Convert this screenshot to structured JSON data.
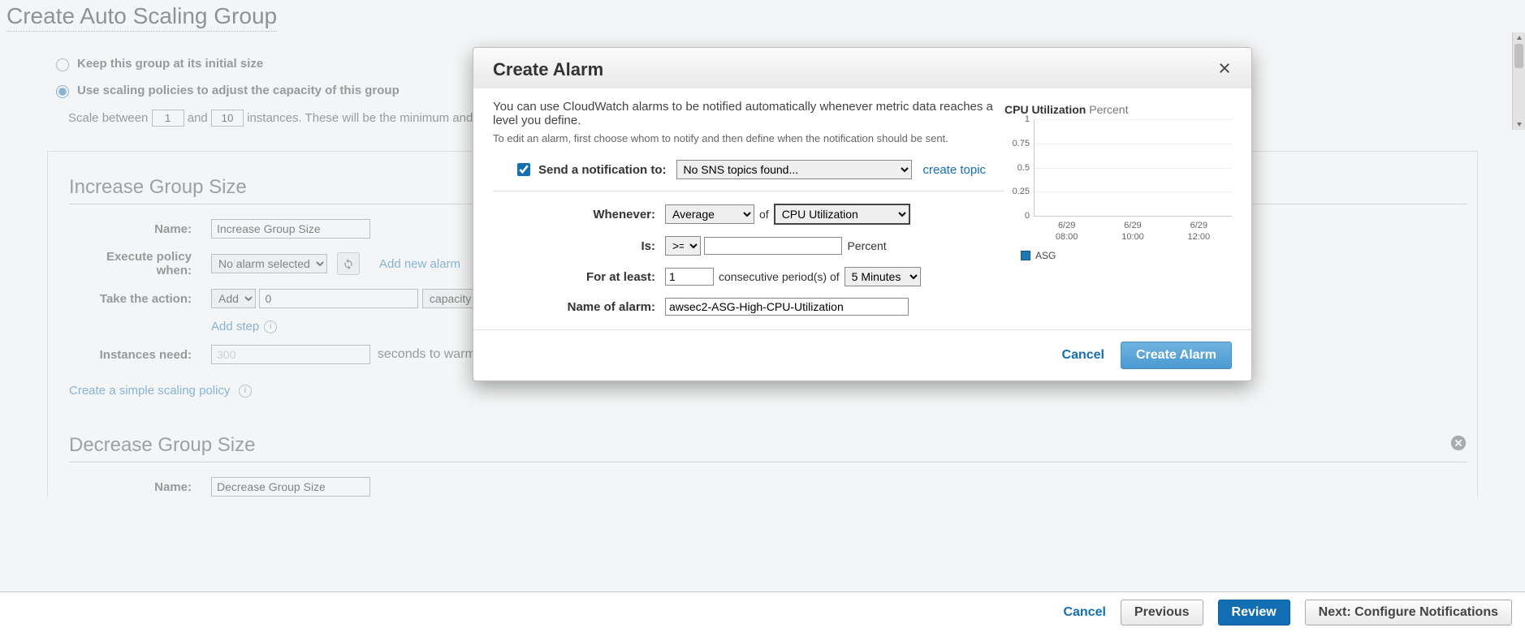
{
  "page": {
    "title": "Create Auto Scaling Group",
    "option_keep": "Keep this group at its initial size",
    "option_policies": "Use scaling policies to adjust the capacity of this group",
    "scale_between_pre": "Scale between",
    "scale_min": "1",
    "scale_and": "and",
    "scale_max": "10",
    "scale_between_post": "instances. These will be the minimum and",
    "increase": {
      "title": "Increase Group Size",
      "name_label": "Name:",
      "name_value": "Increase Group Size",
      "execute_label": "Execute policy when:",
      "alarm_selected": "No alarm selected",
      "add_alarm": "Add new alarm",
      "action_label": "Take the action:",
      "action_verb": "Add",
      "action_value": "0",
      "action_unit": "capacity units",
      "add_step": "Add step",
      "instances_label": "Instances need:",
      "warm_value": "300",
      "warm_post": "seconds to warm up after each step",
      "simple_link": "Create a simple scaling policy"
    },
    "decrease": {
      "title": "Decrease Group Size",
      "name_label": "Name:",
      "name_value": "Decrease Group Size"
    },
    "footer": {
      "cancel": "Cancel",
      "previous": "Previous",
      "review": "Review",
      "next": "Next: Configure Notifications"
    }
  },
  "modal": {
    "title": "Create Alarm",
    "desc1": "You can use CloudWatch alarms to be notified automatically whenever metric data reaches a level you define.",
    "desc2": "To edit an alarm, first choose whom to notify and then define when the notification should be sent.",
    "send_label": "Send a notification to:",
    "sns_selected": "No SNS topics found...",
    "create_topic": "create topic",
    "whenever_label": "Whenever:",
    "stat": "Average",
    "of": "of",
    "metric": "CPU Utilization",
    "is_label": "Is:",
    "comparator": ">=",
    "threshold": "",
    "unit": "Percent",
    "for_label": "For at least:",
    "periods": "1",
    "consecutive": "consecutive period(s) of",
    "period_len": "5 Minutes",
    "name_label": "Name of alarm:",
    "name_value": "awsec2-ASG-High-CPU-Utilization",
    "cancel": "Cancel",
    "create": "Create Alarm"
  },
  "chart_data": {
    "type": "line",
    "title": "CPU Utilization",
    "subtitle": "Percent",
    "ylim": [
      0,
      1
    ],
    "yticks": [
      0,
      0.25,
      0.5,
      0.75,
      1
    ],
    "x_categories": [
      "6/29 08:00",
      "6/29 10:00",
      "6/29 12:00"
    ],
    "series": [
      {
        "name": "ASG",
        "color": "#1f77b4",
        "values": []
      }
    ]
  }
}
